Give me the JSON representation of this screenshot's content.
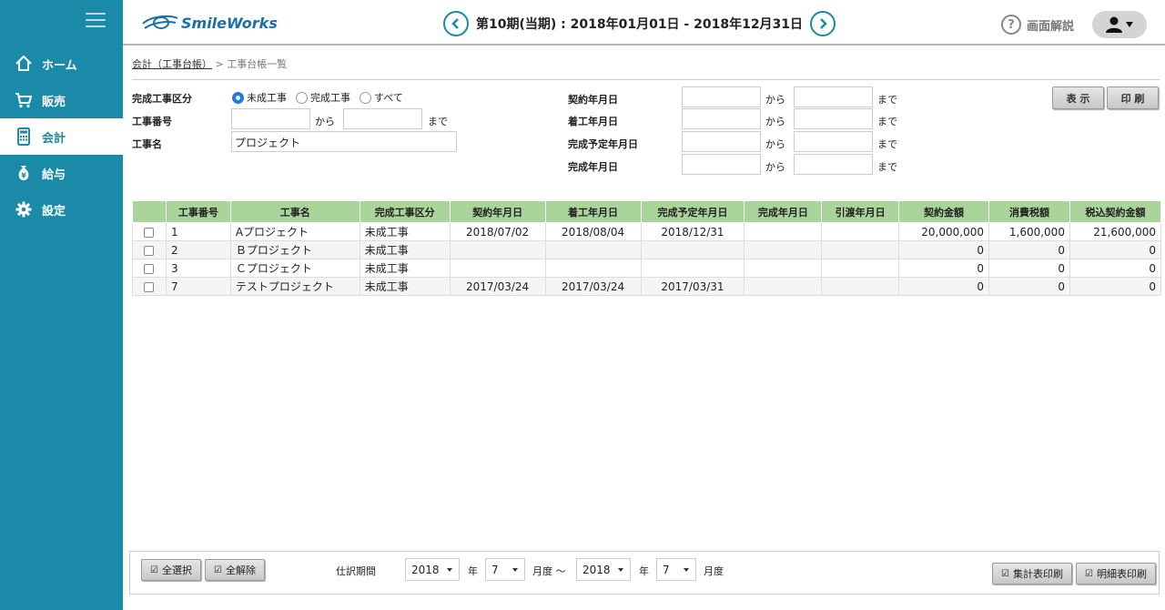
{
  "sidebar": {
    "items": [
      {
        "label": "ホーム",
        "icon": "home-icon"
      },
      {
        "label": "販売",
        "icon": "cart-icon"
      },
      {
        "label": "会計",
        "icon": "calculator-icon"
      },
      {
        "label": "給与",
        "icon": "money-bag-icon"
      },
      {
        "label": "設定",
        "icon": "gear-icon"
      }
    ],
    "active_index": 2
  },
  "header": {
    "logo_text": "SmileWorks",
    "period_text": "第10期(当期) : 2018年01月01日 - 2018年12月31日",
    "help_label": "画面解説"
  },
  "breadcrumb": {
    "link": "会計（工事台帳）",
    "separator": ">",
    "current": "工事台帳一覧"
  },
  "form": {
    "status_label": "完成工事区分",
    "status_options": [
      "未成工事",
      "完成工事",
      "すべて"
    ],
    "status_selected": "未成工事",
    "number_label": "工事番号",
    "name_label": "工事名",
    "name_value": "プロジェクト",
    "from_text": "から",
    "to_text": "まで",
    "contract_date_label": "契約年月日",
    "start_date_label": "着工年月日",
    "planned_completion_label": "完成予定年月日",
    "completion_date_label": "完成年月日",
    "show_button": "表 示",
    "print_button": "印 刷"
  },
  "table": {
    "headers": [
      "",
      "工事番号",
      "工事名",
      "完成工事区分",
      "契約年月日",
      "着工年月日",
      "完成予定年月日",
      "完成年月日",
      "引渡年月日",
      "契約金額",
      "消費税額",
      "税込契約金額"
    ],
    "rows": [
      {
        "no": "1",
        "name": "Aプロジェクト",
        "status": "未成工事",
        "contract": "2018/07/02",
        "start": "2018/08/04",
        "planned": "2018/12/31",
        "completed": "",
        "delivered": "",
        "amount": "20,000,000",
        "tax": "1,600,000",
        "total": "21,600,000"
      },
      {
        "no": "2",
        "name": "Ｂプロジェクト",
        "status": "未成工事",
        "contract": "",
        "start": "",
        "planned": "",
        "completed": "",
        "delivered": "",
        "amount": "0",
        "tax": "0",
        "total": "0"
      },
      {
        "no": "3",
        "name": "Ｃプロジェクト",
        "status": "未成工事",
        "contract": "",
        "start": "",
        "planned": "",
        "completed": "",
        "delivered": "",
        "amount": "0",
        "tax": "0",
        "total": "0"
      },
      {
        "no": "7",
        "name": "テストプロジェクト",
        "status": "未成工事",
        "contract": "2017/03/24",
        "start": "2017/03/24",
        "planned": "2017/03/31",
        "completed": "",
        "delivered": "",
        "amount": "0",
        "tax": "0",
        "total": "0"
      }
    ]
  },
  "footer": {
    "select_all": "全選択",
    "deselect_all": "全解除",
    "journal_period_label": "仕訳期間",
    "from_year": "2018",
    "year_text": "年",
    "from_month": "7",
    "month_text_range": "月度 〜",
    "to_year": "2018",
    "to_month": "7",
    "month_text": "月度",
    "summary_print": "集計表印刷",
    "detail_print": "明細表印刷"
  },
  "colors": {
    "sidebar": "#1a8aa8",
    "table_header": "#a9d49a",
    "radio_selected": "#1e7be0"
  }
}
